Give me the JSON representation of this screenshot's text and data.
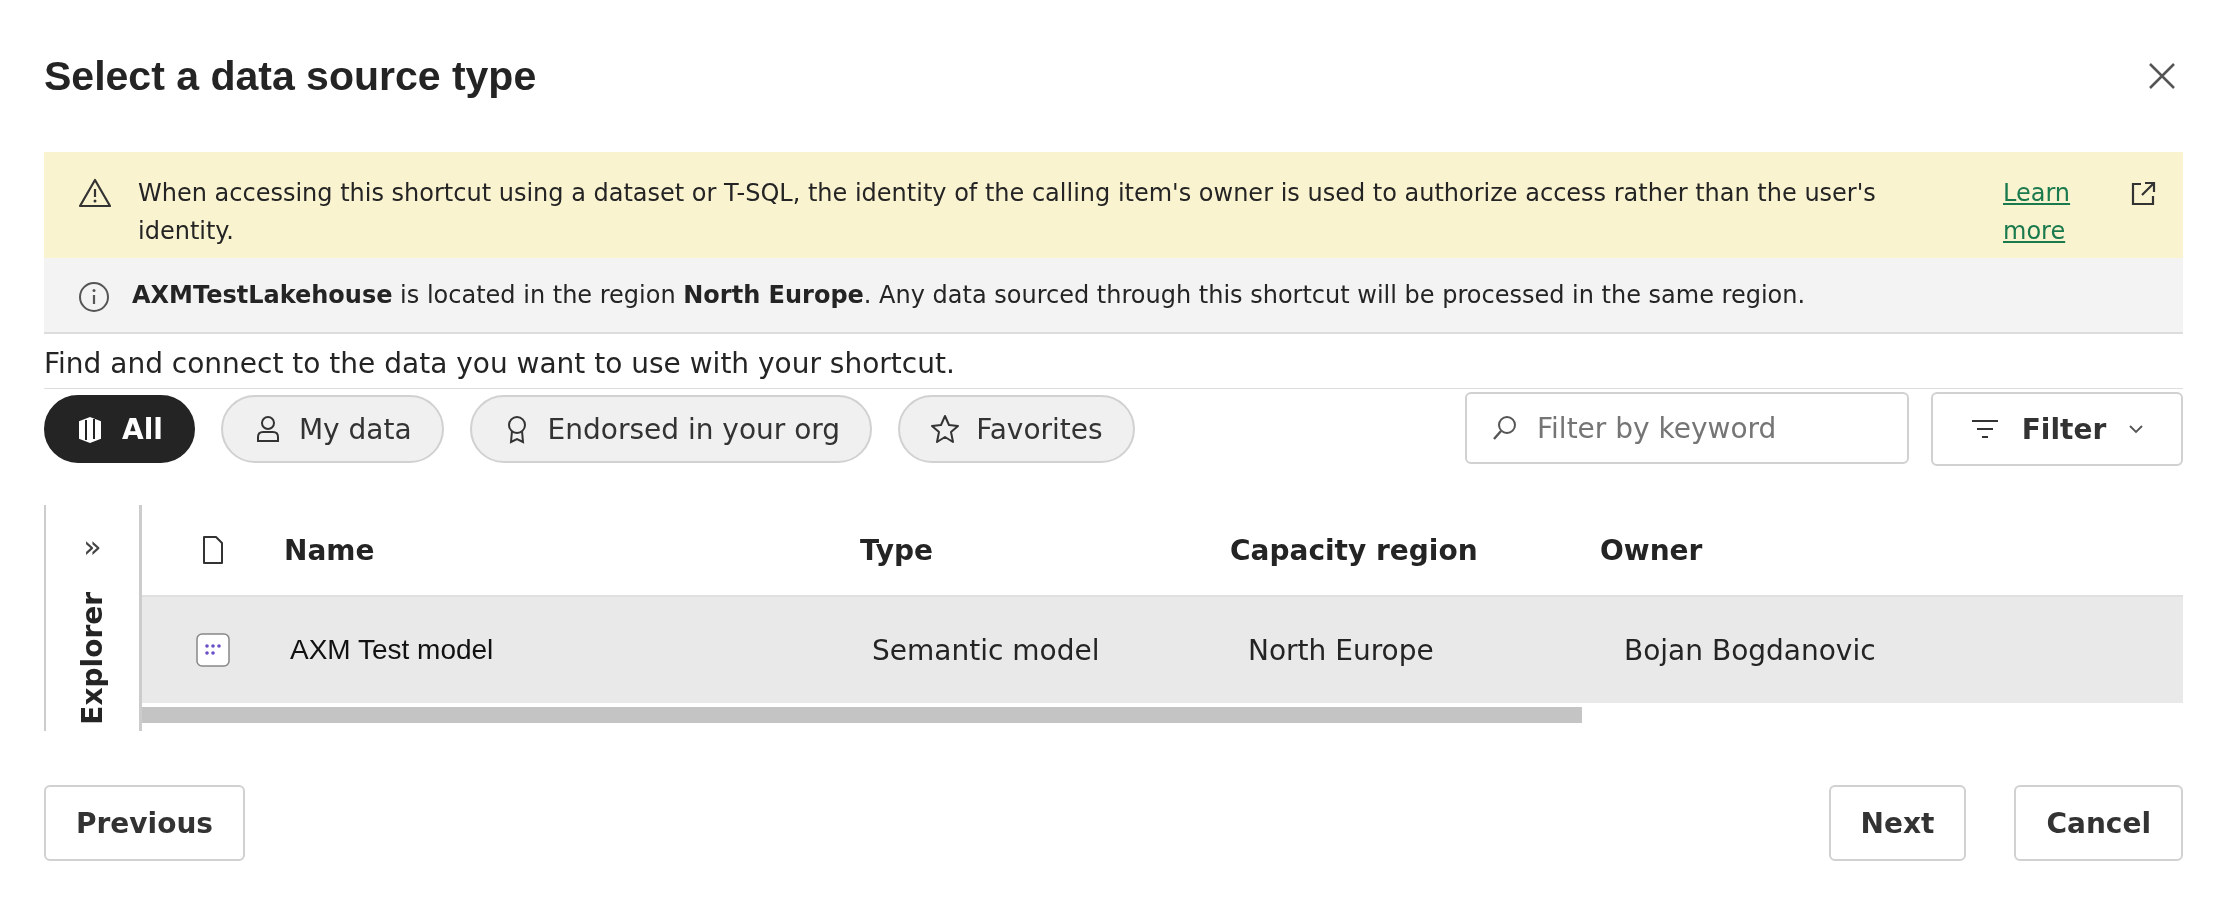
{
  "dialog": {
    "title": "Select a data source type"
  },
  "warning": {
    "text": "When accessing this shortcut using a dataset or T-SQL, the identity of the calling item's owner is used to authorize access rather than the user's identity.",
    "link": "Learn more"
  },
  "info": {
    "text": "**AXMTestLakehouse** is located in the region **North Europe**. Any data sourced through this shortcut will be processed in the same region."
  },
  "description": "Find and connect to the data you want to use with your shortcut.",
  "filter_chips": [
    {
      "kind": "all",
      "label": "All",
      "selected": true
    },
    {
      "kind": "person",
      "label": "My data",
      "selected": false
    },
    {
      "kind": "ribbon",
      "label": "Endorsed in your org",
      "selected": false
    },
    {
      "kind": "star",
      "label": "Favorites",
      "selected": false
    }
  ],
  "search": {
    "placeholder": "Filter by keyword"
  },
  "filter_button": {
    "label": "Filter"
  },
  "explorer": {
    "label": "Explorer",
    "expand_glyph": "»"
  },
  "table": {
    "columns": [
      "Name",
      "Type",
      "Capacity region",
      "Owner"
    ],
    "rows": [
      {
        "name": "AXM Test model",
        "type": "Semantic model",
        "capacity_region": "North Europe",
        "owner": "Bojan Bogdanovic",
        "selected": true
      }
    ]
  },
  "buttons": {
    "previous": "Previous",
    "next": "Next",
    "cancel": "Cancel"
  }
}
